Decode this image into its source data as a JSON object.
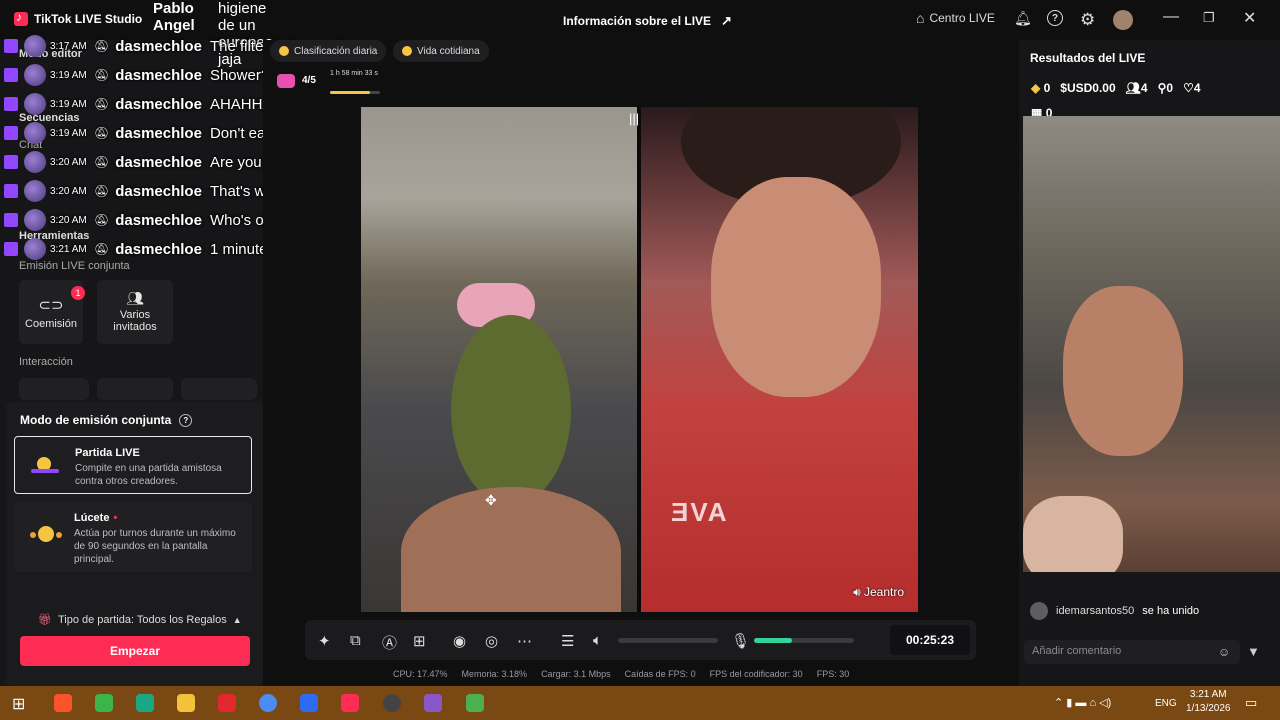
{
  "app": {
    "name": "TikTok LIVE Studio"
  },
  "topbar": {
    "live_info": "Información sobre el LIVE",
    "center_live": "Centro LIVE",
    "avatar_icon": "user-avatar"
  },
  "left_panel": {
    "overlay_top": {
      "line1": "Pablo",
      "line2": "Angel",
      "msg_line1": "higiene de un",
      "msg_line2": "europeo jaja"
    },
    "sections": {
      "edit_mode": "Modo editor",
      "sequences": "Secuencias",
      "chat": "Chat",
      "tools": "Herramientas",
      "joint_live": "Emisión LIVE conjunta",
      "interaction": "Interacción"
    },
    "tools": [
      {
        "label": "Coemisión",
        "badge": "1",
        "icon": "link-icon"
      },
      {
        "label": "Varios invitados",
        "icon": "users-icon"
      }
    ],
    "mode": {
      "title": "Modo de emisión conjunta",
      "options": [
        {
          "title": "Partida LIVE",
          "desc": "Compite en una partida amistosa contra otros creadores."
        },
        {
          "title": "Lúcete",
          "desc": "Actúa por turnos durante un máximo de 90 segundos en la pantalla principal."
        }
      ],
      "match_type": "Tipo de partida: Todos los Regalos",
      "start": "Empezar"
    }
  },
  "chat": [
    {
      "time": "3:17 AM",
      "user": "dasmechloe",
      "msg": "The filter is funny af"
    },
    {
      "time": "3:19 AM",
      "user": "dasmechloe",
      "msg": "Shower?"
    },
    {
      "time": "3:19 AM",
      "user": "dasmechloe",
      "msg": "AHAHHAHAHAHA"
    },
    {
      "time": "3:19 AM",
      "user": "dasmechloe",
      "msg": "Don't eat it lol"
    },
    {
      "time": "3:20 AM",
      "user": "dasmechloe",
      "msg": "Are you twins?"
    },
    {
      "time": "3:20 AM",
      "user": "dasmechloe",
      "msg": "That's why"
    },
    {
      "time": "3:20 AM",
      "user": "dasmechloe",
      "msg": "Who's older?"
    },
    {
      "time": "3:21 AM",
      "user": "dasmechloe",
      "msg": "1 minute"
    }
  ],
  "stage": {
    "chips": [
      "Clasificación diaria",
      "Vida cotidiana"
    ],
    "goal": {
      "count": "4/5",
      "timer": "1 h 58 min 33 s",
      "progress": 0.8
    },
    "cohost_name": "Jeantro",
    "timer": "00:25:23",
    "stats": [
      "CPU: 17.47%",
      "Memoria: 3.18%",
      "Cargar: 3.1 Mbps",
      "Caídas de FPS: 0",
      "FPS del codificador: 30",
      "FPS: 30"
    ],
    "mic_level": 0.38,
    "volume_level": 0.0
  },
  "right_panel": {
    "title": "Resultados del LIVE",
    "stats": {
      "diamonds": "0",
      "usd": "USD0.00",
      "viewers": "4",
      "followers": "0",
      "likes": "4",
      "gifts": "0"
    },
    "joined_user": "idemarsantos50",
    "joined_text": "se ha unido",
    "comment_placeholder": "Añadir comentario"
  },
  "taskbar": {
    "lang": "ENG",
    "time": "3:21 AM",
    "date": "1/13/2026"
  }
}
